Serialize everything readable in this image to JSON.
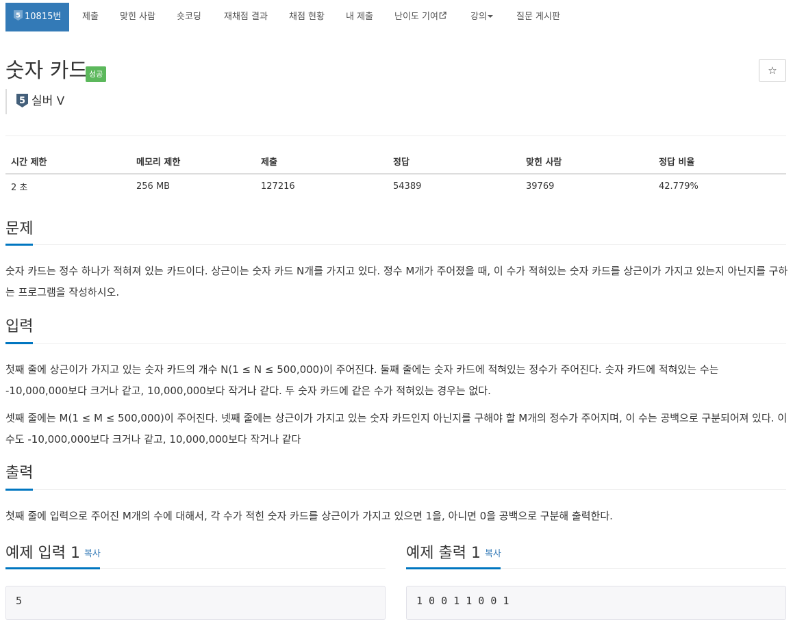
{
  "nav": {
    "problem_id": "10815번",
    "items": [
      "제출",
      "맞힌 사람",
      "숏코딩",
      "재채점 결과",
      "채점 현황",
      "내 제출",
      "난이도 기여",
      "강의",
      "질문 게시판"
    ]
  },
  "tier_badge_number": "5",
  "problem": {
    "title": "숫자 카드",
    "status_label": "성공",
    "star_glyph": "☆",
    "tier": "실버 V"
  },
  "info_table": {
    "headers": [
      "시간 제한",
      "메모리 제한",
      "제출",
      "정답",
      "맞힌 사람",
      "정답 비율"
    ],
    "values": [
      "2 초",
      "256 MB",
      "127216",
      "54389",
      "39769",
      "42.779%"
    ]
  },
  "sections": {
    "problem_title": "문제",
    "problem_text": "숫자 카드는 정수 하나가 적혀져 있는 카드이다. 상근이는 숫자 카드 N개를 가지고 있다. 정수 M개가 주어졌을 때, 이 수가 적혀있는 숫자 카드를 상근이가 가지고 있는지 아닌지를 구하는 프로그램을 작성하시오.",
    "input_title": "입력",
    "input_text_1": "첫째 줄에 상근이가 가지고 있는 숫자 카드의 개수 N(1 ≤ N ≤ 500,000)이 주어진다. 둘째 줄에는 숫자 카드에 적혀있는 정수가 주어진다. 숫자 카드에 적혀있는 수는 -10,000,000보다 크거나 같고, 10,000,000보다 작거나 같다. 두 숫자 카드에 같은 수가 적혀있는 경우는 없다.",
    "input_text_2": "셋째 줄에는 M(1 ≤ M ≤ 500,000)이 주어진다. 넷째 줄에는 상근이가 가지고 있는 숫자 카드인지 아닌지를 구해야 할 M개의 정수가 주어지며, 이 수는 공백으로 구분되어져 있다. 이 수도 -10,000,000보다 크거나 같고, 10,000,000보다 작거나 같다",
    "output_title": "출력",
    "output_text": "첫째 줄에 입력으로 주어진 M개의 수에 대해서, 각 수가 적힌 숫자 카드를 상근이가 가지고 있으면 1을, 아니면 0을 공백으로 구분해 출력한다."
  },
  "examples": {
    "input_title": "예제 입력 1",
    "output_title": "예제 출력 1",
    "copy_label": "복사",
    "input_value": "5",
    "output_value": "1 0 0 1 1 0 0 1"
  },
  "colors": {
    "accent": "#337ab7",
    "success": "#5cb85c",
    "tier_silver": "#435f7a",
    "section_underline": "#0076c0"
  }
}
